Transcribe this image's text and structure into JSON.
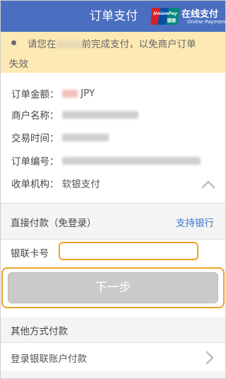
{
  "header": {
    "title": "订单支付",
    "brand_main": "在线支付",
    "brand_sub": "Online Payment",
    "logo_text_top": "UnionPay",
    "logo_text_bottom": "银联",
    "bg_color": "#4a6fc0"
  },
  "notice": {
    "text_before": "请您在",
    "text_after": "前完成支付，以免商户订单",
    "text_line2": "失效",
    "bg_color": "#fce9b4"
  },
  "order": {
    "amount_label": "订单金额：",
    "amount_currency": "JPY",
    "merchant_label": "商户名称：",
    "time_label": "交易时间：",
    "order_no_label": "订单编号：",
    "acquirer_label": "收单机构：",
    "acquirer_value": "软银支付"
  },
  "direct_pay": {
    "label": "直接付款（免登录）",
    "support_banks": "支持银行",
    "link_color": "#3a7bd5"
  },
  "card": {
    "label": "银联卡号",
    "value": "",
    "placeholder": ""
  },
  "next_button": {
    "label": "下一步"
  },
  "other_methods": {
    "header": "其他方式付款",
    "login_label": "登录银联账户付款"
  },
  "icons": {
    "logo": "unionpay-logo",
    "collapse": "chevron-up-icon",
    "forward": "chevron-right-icon",
    "bullet": "bullet-dot-icon"
  },
  "accent_color": "#f0a21e"
}
